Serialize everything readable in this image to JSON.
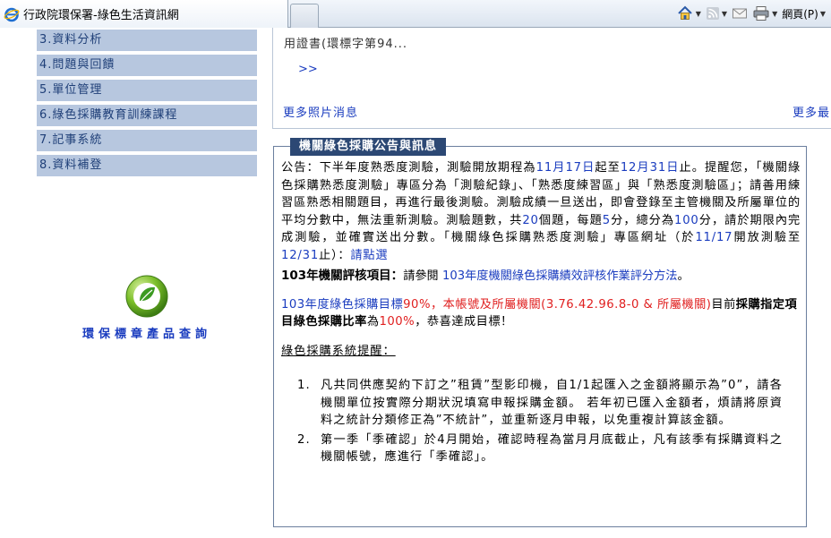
{
  "browser": {
    "tab_title": "行政院環保署-綠色生活資訊網",
    "menu_page": "網頁(P)"
  },
  "sidebar": {
    "items": [
      {
        "label": "3.資料分析"
      },
      {
        "label": "4.問題與回饋"
      },
      {
        "label": "5.單位管理"
      },
      {
        "label": "6.綠色採購教育訓練課程"
      },
      {
        "label": "7.記事系統"
      },
      {
        "label": "8.資料補登"
      }
    ],
    "eco_label": "環保標章產品查詢"
  },
  "news": {
    "snippet": "用證書(環標字第94...",
    "arrow": ">>",
    "more_left": "更多照片消息",
    "more_right": "更多最"
  },
  "announcement": {
    "legend": "機關綠色採購公告與訊息",
    "p1": {
      "a": "公告：下半年度熟悉度測驗，測驗開放期程為",
      "date1": "11月17日",
      "b": "起至",
      "date2": "12月31日",
      "c": "止。提醒您，「機關綠色採購熟悉度測驗」專區分為「測驗紀錄」、「熟悉度練習區」與「熟悉度測驗區」；請善用練習區熟悉相關題目，再進行最後測驗。測驗成績一旦送出，即會登錄至主管機關及所屬單位的平均分數中，無法重新測驗。測驗題數，共",
      "n1": "20",
      "d": "個題，每題",
      "n2": "5",
      "e": "分，總分為",
      "n3": "100",
      "f": "分，請於期限內完成測驗，並確實送出分數。「機關綠色採購熟悉度測驗」專區網址（於",
      "date3": "11/17",
      "g": "開放測驗至",
      "date4": "12/31",
      "h": "止）：",
      "link": "請點選"
    },
    "p2": {
      "title": "103年機關評核項目：",
      "a": "請參閱",
      "link": "103年度機關綠色採購績效評核作業評分方法",
      "b": "。"
    },
    "p3": {
      "a": "103年度綠色採購目標",
      "pct1": "90%",
      "b": "，本帳號及所屬機關(3.76.42.96.8-0 & 所屬機關)",
      "c": "目前",
      "d": "採購指定項目綠色採購比率",
      "e": "為",
      "pct2": "100%",
      "f": "，恭喜達成目標！"
    },
    "p4": "綠色採購系統提醒：",
    "list": [
      {
        "num": "1.",
        "text": "凡共同供應契約下訂之”租賃”型影印機，自1/1起匯入之金額將顯示為”0”，請各機關單位按實際分期狀況填寫申報採購金額。 若年初已匯入金額者，煩請將原資料之統計分類修正為”不統計”，並重新逐月申報，以免重複計算該金額。"
      },
      {
        "num": "2.",
        "text": "第一季「季確認」於4月開始，確認時程為當月月底截止，凡有該季有採購資料之機關帳號，應進行「季確認」。"
      }
    ]
  }
}
